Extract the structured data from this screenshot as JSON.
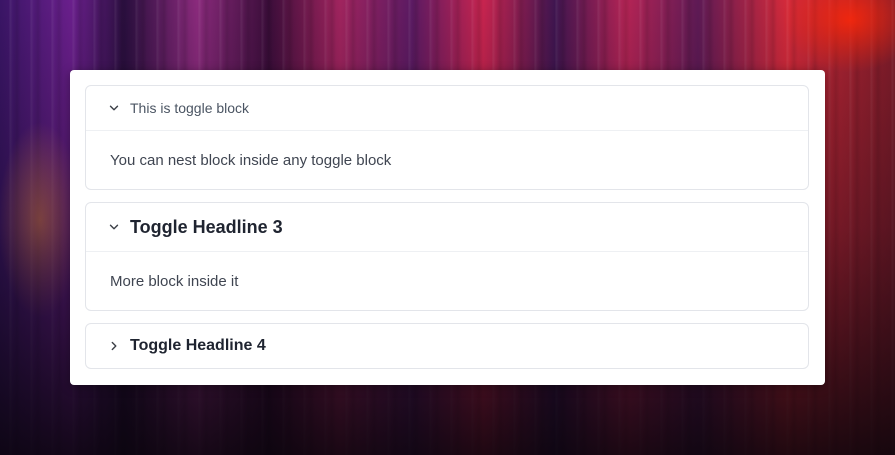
{
  "toggles": [
    {
      "title": "This is toggle block",
      "expanded": true,
      "style": "paragraph",
      "content": "You can nest block inside any toggle block",
      "icon": "chevron-down-icon"
    },
    {
      "title": "Toggle Headline 3",
      "expanded": true,
      "style": "heading-3",
      "content": "More block inside it",
      "icon": "chevron-down-icon"
    },
    {
      "title": "Toggle Headline 4",
      "expanded": false,
      "style": "heading-4",
      "content": "",
      "icon": "chevron-right-icon"
    }
  ],
  "colors": {
    "card_background": "#ffffff",
    "border": "#e3e5ea",
    "heading_text": "#1f2430",
    "body_text": "#3f4551"
  }
}
